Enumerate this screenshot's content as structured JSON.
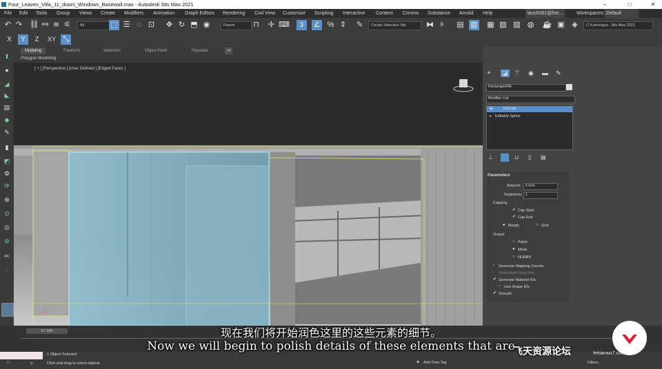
{
  "window": {
    "title": "Four_Leaves_Villa_11_doors_Windows_Basewall.max - Autodesk 3ds Max 2021",
    "minimize": "–",
    "maximize": "□",
    "close": "✕"
  },
  "menus": [
    "File",
    "Edit",
    "Tools",
    "Group",
    "Views",
    "Create",
    "Modifiers",
    "Animation",
    "Graph Editors",
    "Rendering",
    "Civil View",
    "Customize",
    "Scripting",
    "Interactive",
    "Content",
    "Corona",
    "Substance",
    "Arnold",
    "Help"
  ],
  "account": {
    "user": "lavo5391@hot...",
    "workspaces_label": "Workspaces:",
    "workspace": "Default"
  },
  "toolbar": {
    "selection_filter": "All",
    "reference_coord": "Parent",
    "named_selection": "Create Selection Set",
    "project_path": "C:\\Users\\gus...3ds Max 2021",
    "snap_number": "3",
    "axis_x": "X",
    "axis_y": "Y",
    "axis_z": "Z",
    "axis_xy": "XY"
  },
  "ribbon": {
    "tabs": [
      "Modeling",
      "Freeform",
      "Selection",
      "Object Paint",
      "Populate"
    ],
    "active": "Modeling",
    "sublabel": "Polygon Modeling"
  },
  "viewport": {
    "label": "[ + ] [Perspective ] [User Defined ] [Edged Faces ]"
  },
  "command_panel": {
    "object_name": "Rectangle045",
    "modifier_list": "Modifier List",
    "stack": [
      "Extrude",
      "Editable Spline"
    ],
    "parameters": {
      "title": "Parameters",
      "amount_label": "Amount:",
      "amount": "5.0cm",
      "segments_label": "Segments:",
      "segments": "1",
      "capping_label": "Capping",
      "cap_start": "Cap Start",
      "cap_end": "Cap End",
      "morph": "Morph",
      "grid": "Grid",
      "output_label": "Output",
      "patch": "Patch",
      "mesh": "Mesh",
      "nurbs": "NURBS",
      "gen_mapping": "Generate Mapping Coords.",
      "real_world": "Real-World Map Size",
      "gen_material": "Generate Material IDs",
      "use_shape": "Use Shape IDs",
      "smooth": "Smooth"
    }
  },
  "timeline": {
    "frame": "0 / 100"
  },
  "status": {
    "selected": "1 Object Selected",
    "prompt": "Click-and-drag to select objects",
    "add_time_tag": "Add Time Tag",
    "filters": "Filters..."
  },
  "subtitles": {
    "chinese": "现在我们将开始润色这里的这些元素的细节。",
    "english": "Now we will begin to polish details of these elements that are"
  },
  "watermark": {
    "site": "飞天资源论坛",
    "url": "feitianwu7.com"
  }
}
